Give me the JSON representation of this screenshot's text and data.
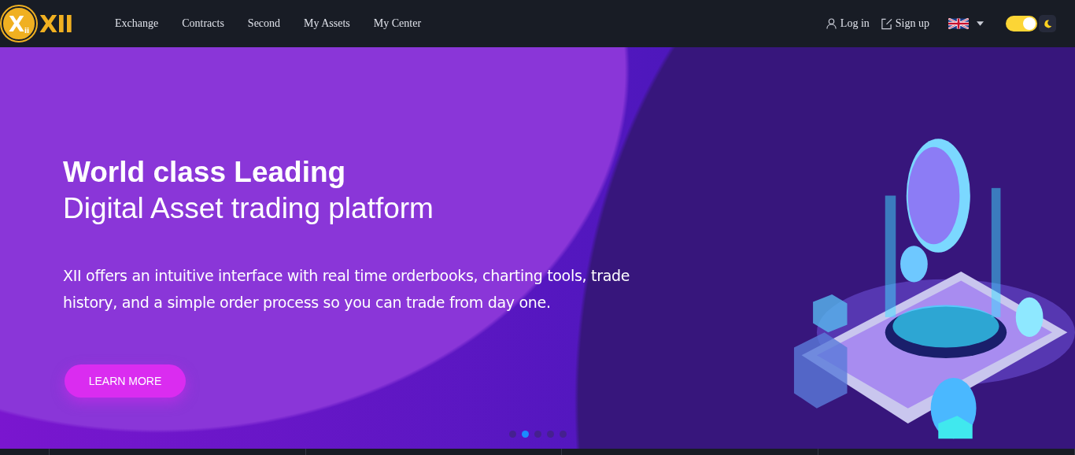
{
  "logo": {
    "mark": "X",
    "mark_sub": "ii",
    "wordmark": "XII"
  },
  "nav": [
    {
      "label": "Exchange"
    },
    {
      "label": "Contracts"
    },
    {
      "label": "Second"
    },
    {
      "label": "My Assets"
    },
    {
      "label": "My Center"
    }
  ],
  "account": [
    {
      "kind": "login",
      "label": "Log in"
    },
    {
      "kind": "signup",
      "label": "Sign up"
    }
  ],
  "theme_toggle": {
    "on": true
  },
  "hero": {
    "title": "World class Leading",
    "subtitle": "Digital Asset trading platform",
    "description": "XII offers an intuitive interface with real time orderbooks, charting tools, trade history, and a simple order process so you can trade from day one.",
    "button": "LEARN MORE",
    "dots": [
      {
        "selected": false
      },
      {
        "selected": true
      },
      {
        "selected": false
      },
      {
        "selected": false
      },
      {
        "selected": false
      }
    ]
  }
}
